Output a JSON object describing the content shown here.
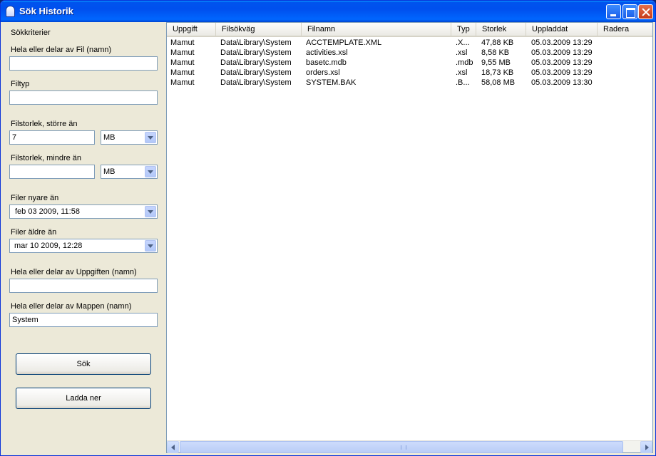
{
  "window": {
    "title": "Sök Historik"
  },
  "search": {
    "heading": "Sökkriterier",
    "filename_label": "Hela eller delar av Fil (namn)",
    "filename_value": "",
    "filetype_label": "Filtyp",
    "filetype_value": "",
    "size_larger_label": "Filstorlek, större än",
    "size_larger_value": "7",
    "size_larger_unit": "MB",
    "size_smaller_label": "Filstorlek, mindre än",
    "size_smaller_value": "",
    "size_smaller_unit": "MB",
    "newer_label": "Filer nyare än",
    "newer_value": "feb 03 2009,  11:58",
    "older_label": "Filer äldre än",
    "older_value": "mar 10 2009,  12:28",
    "task_label": "Hela eller delar av Uppgiften (namn)",
    "task_value": "",
    "folder_label": "Hela eller delar av Mappen (namn)",
    "folder_value": "System",
    "search_button": "Sök",
    "download_button": "Ladda ner"
  },
  "list": {
    "columns": [
      "Uppgift",
      "Filsökväg",
      "Filnamn",
      "Typ",
      "Storlek",
      "Uppladdat",
      "Radera"
    ],
    "rows": [
      [
        "Mamut",
        "Data\\Library\\System",
        "ACCTEMPLATE.XML",
        ".X...",
        "47,88 KB",
        "05.03.2009 13:29"
      ],
      [
        "Mamut",
        "Data\\Library\\System",
        "activities.xsl",
        ".xsl",
        "8,58 KB",
        "05.03.2009 13:29"
      ],
      [
        "Mamut",
        "Data\\Library\\System",
        "basetc.mdb",
        ".mdb",
        "9,55 MB",
        "05.03.2009 13:29"
      ],
      [
        "Mamut",
        "Data\\Library\\System",
        "orders.xsl",
        ".xsl",
        "18,73 KB",
        "05.03.2009 13:29"
      ],
      [
        "Mamut",
        "Data\\Library\\System",
        "SYSTEM.BAK",
        ".B...",
        "58,08 MB",
        "05.03.2009 13:30"
      ]
    ]
  }
}
